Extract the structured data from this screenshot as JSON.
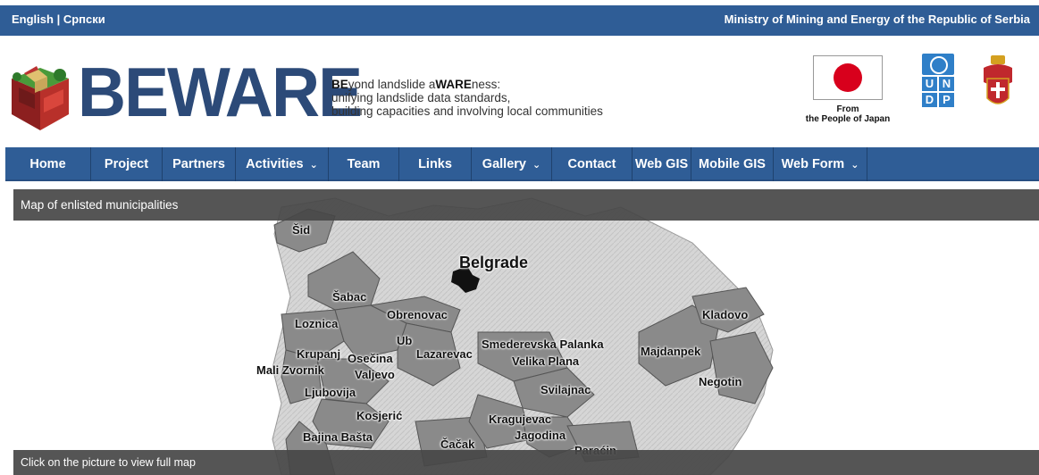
{
  "topbar": {
    "lang_en": "English",
    "lang_sep": " | ",
    "lang_sr": "Српски",
    "ministry": "Ministry of Mining and Energy of the Republic of Serbia"
  },
  "header": {
    "logo_text": "BEWARE",
    "tagline_bold1": "BE",
    "tagline_mid1": "yond landslide a",
    "tagline_bold2": "WARE",
    "tagline_end1": "ness:",
    "tagline_line2": "unifying landslide data standards,",
    "tagline_line3": "building capacities and involving local communities",
    "japan_from": "From",
    "japan_people": "the People of Japan",
    "undp_letters": [
      "U",
      "N",
      "D",
      "P"
    ]
  },
  "nav": {
    "items": [
      {
        "label": "Home",
        "dropdown": false
      },
      {
        "label": "Project",
        "dropdown": false
      },
      {
        "label": "Partners",
        "dropdown": false
      },
      {
        "label": "Activities",
        "dropdown": true
      },
      {
        "label": "Team",
        "dropdown": false
      },
      {
        "label": "Links",
        "dropdown": false
      },
      {
        "label": "Gallery",
        "dropdown": true
      },
      {
        "label": "Contact",
        "dropdown": false
      },
      {
        "label": "Web GIS",
        "dropdown": false
      },
      {
        "label": "Mobile GIS",
        "dropdown": false
      },
      {
        "label": "Web Form",
        "dropdown": true
      }
    ]
  },
  "panel": {
    "title": "Map of enlisted municipalities",
    "footer": "Click on the picture to view full map"
  },
  "map": {
    "labels": [
      "Šid",
      "Belgrade",
      "Šabac",
      "Obrenovac",
      "Loznica",
      "Ub",
      "Krupanj",
      "Osečina",
      "Lazarevac",
      "Mali Zvornik",
      "Valjevo",
      "Ljubovija",
      "Kosjerić",
      "Bajina Bašta",
      "Čačak",
      "Smederevska Palanka",
      "Velika Plana",
      "Svilajnac",
      "Kragujevac",
      "Jagodina",
      "Paraćin",
      "Kladovo",
      "Majdanpek",
      "Negotin"
    ]
  },
  "colors": {
    "brand_blue": "#2f5d96",
    "logo_navy": "#2c4a78",
    "japan_red": "#d8001c",
    "undp_blue": "#2f7fc8"
  }
}
